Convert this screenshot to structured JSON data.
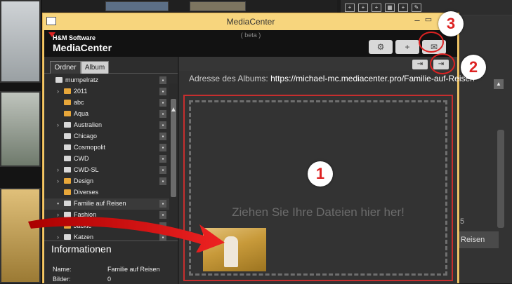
{
  "window": {
    "title": "MediaCenter"
  },
  "header": {
    "brand_small": "H&M Software",
    "brand_big": "MediaCenter",
    "beta": "( beta )",
    "buttons": [
      {
        "name": "settings",
        "icon": "gear-icon",
        "glyph": "⚙"
      },
      {
        "name": "new-folder",
        "icon": "folder-add-icon",
        "glyph": "+"
      },
      {
        "name": "mail",
        "icon": "mail-icon",
        "glyph": "✉"
      }
    ]
  },
  "sidebar": {
    "tabs": [
      "Ordner",
      "Album"
    ],
    "active_tab": "Ordner",
    "tree": [
      {
        "label": "mumpelratz",
        "indent": 0,
        "type": "album",
        "chevron": "",
        "lock": true
      },
      {
        "label": "2011",
        "indent": 1,
        "type": "folder",
        "chevron": "›",
        "lock": true
      },
      {
        "label": "abc",
        "indent": 1,
        "type": "folder",
        "chevron": "",
        "lock": true
      },
      {
        "label": "Aqua",
        "indent": 1,
        "type": "folder",
        "chevron": "",
        "lock": true
      },
      {
        "label": "Australien",
        "indent": 1,
        "type": "album",
        "chevron": "›",
        "lock": true
      },
      {
        "label": "Chicago",
        "indent": 1,
        "type": "album",
        "chevron": "",
        "lock": true
      },
      {
        "label": "Cosmopolit",
        "indent": 1,
        "type": "album",
        "chevron": "",
        "lock": true
      },
      {
        "label": "CWD",
        "indent": 1,
        "type": "album",
        "chevron": "",
        "lock": true
      },
      {
        "label": "CWD-SL",
        "indent": 1,
        "type": "album",
        "chevron": "›",
        "lock": true
      },
      {
        "label": "Design",
        "indent": 1,
        "type": "folder",
        "chevron": "›",
        "lock": true
      },
      {
        "label": "Diverses",
        "indent": 1,
        "type": "folder",
        "chevron": "",
        "lock": false
      },
      {
        "label": "Familie auf Reisen",
        "indent": 1,
        "type": "album",
        "chevron": "▪",
        "lock": true,
        "selected": true
      },
      {
        "label": "Fashion",
        "indent": 1,
        "type": "album",
        "chevron": "›",
        "lock": true
      },
      {
        "label": "Jackie",
        "indent": 1,
        "type": "folder",
        "chevron": "",
        "lock": true
      },
      {
        "label": "Katzen",
        "indent": 1,
        "type": "album",
        "chevron": "›",
        "lock": true
      }
    ],
    "info": {
      "title": "Informationen",
      "name_label": "Name:",
      "name_value": "Familie auf Reisen",
      "images_label": "Bilder:",
      "images_value": "0"
    }
  },
  "main": {
    "album_address_label": "Adresse des Albums:",
    "album_address_url": "https://michael-mc.mediacenter.pro/Familie-auf-Reisen",
    "drop_text": "Ziehen Sie Ihre Dateien hier her!",
    "buttons": [
      {
        "name": "share-left",
        "icon": "share-icon",
        "glyph": "⇥"
      },
      {
        "name": "share-right",
        "icon": "export-icon",
        "glyph": "⇥"
      }
    ]
  },
  "background": {
    "right_number": "5",
    "right_selected_label": "Reisen"
  },
  "annotations": [
    "1",
    "2",
    "3"
  ],
  "colors": {
    "accent_red": "#d22222",
    "window_frame": "#f2c86a",
    "drop_border": "#c72e2e"
  }
}
